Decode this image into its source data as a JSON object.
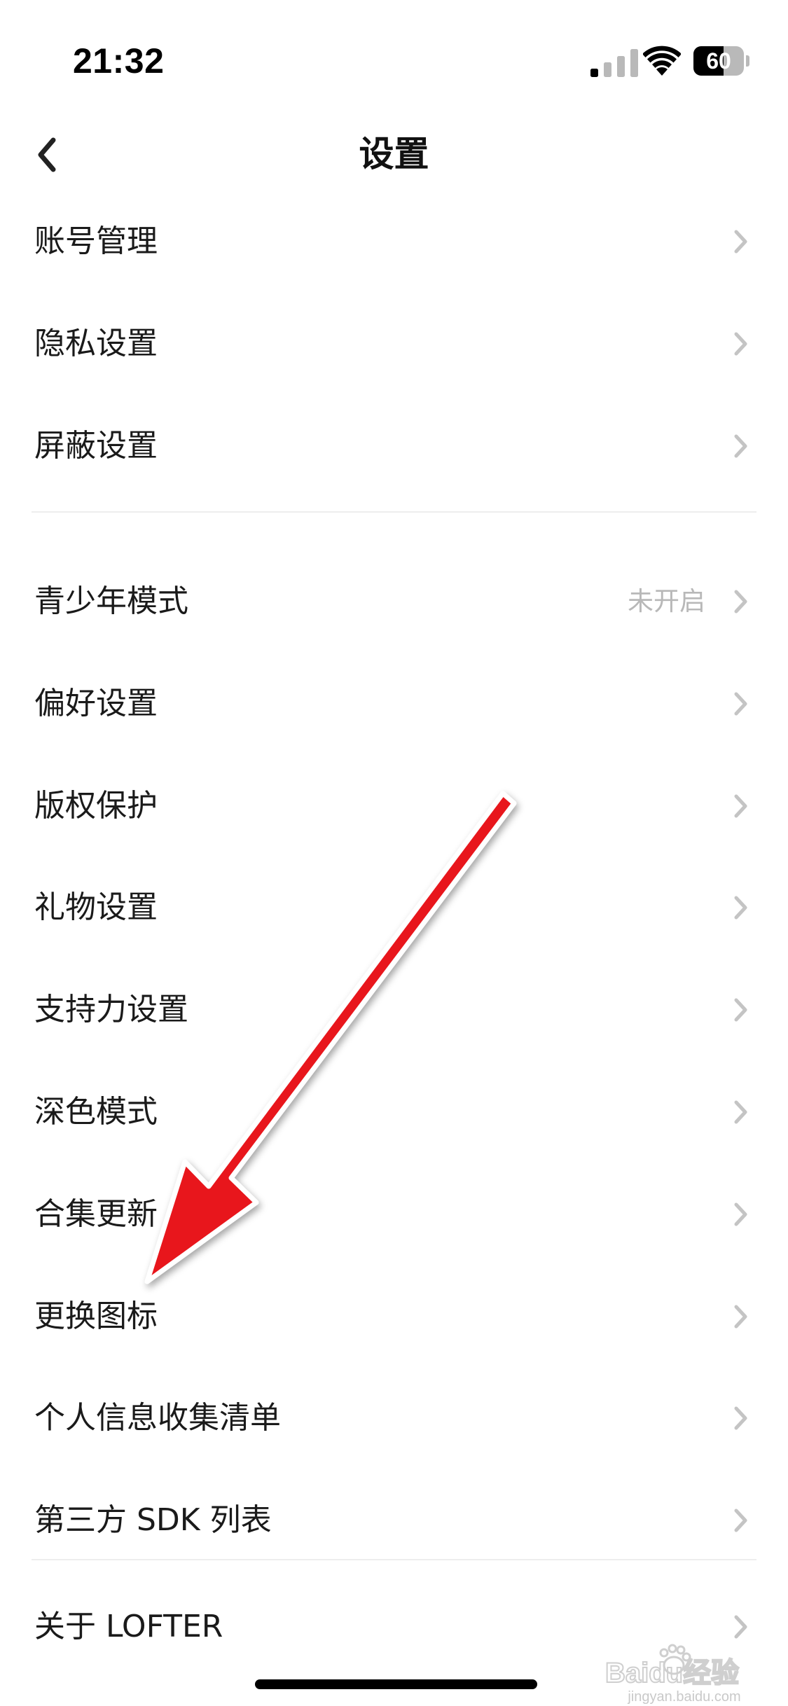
{
  "status_bar": {
    "time": "21:32",
    "battery": "60",
    "battery_level_percent": 60
  },
  "nav": {
    "title": "设置",
    "back_icon": "chevron-left-icon"
  },
  "groups": [
    {
      "items": [
        {
          "label": "账号管理",
          "value": ""
        },
        {
          "label": "隐私设置",
          "value": ""
        },
        {
          "label": "屏蔽设置",
          "value": ""
        }
      ]
    },
    {
      "items": [
        {
          "label": "青少年模式",
          "value": "未开启"
        },
        {
          "label": "偏好设置",
          "value": ""
        },
        {
          "label": "版权保护",
          "value": ""
        },
        {
          "label": "礼物设置",
          "value": ""
        },
        {
          "label": "支持力设置",
          "value": ""
        },
        {
          "label": "深色模式",
          "value": ""
        },
        {
          "label": "合集更新",
          "value": ""
        },
        {
          "label": "更换图标",
          "value": ""
        },
        {
          "label": "个人信息收集清单",
          "value": ""
        },
        {
          "label": "第三方 SDK 列表",
          "value": ""
        }
      ]
    },
    {
      "items": [
        {
          "label": "关于 LOFTER",
          "value": ""
        }
      ]
    }
  ],
  "annotation": {
    "icon": "red-arrow-icon",
    "color": "#e8141a"
  },
  "watermark": {
    "brand": "Baidu经验",
    "url": "jingyan.baidu.com"
  },
  "colors": {
    "text": "#1a1a1a",
    "secondary": "#b8b8b8",
    "chevron": "#c4c4c4",
    "divider": "#eeeeee"
  }
}
